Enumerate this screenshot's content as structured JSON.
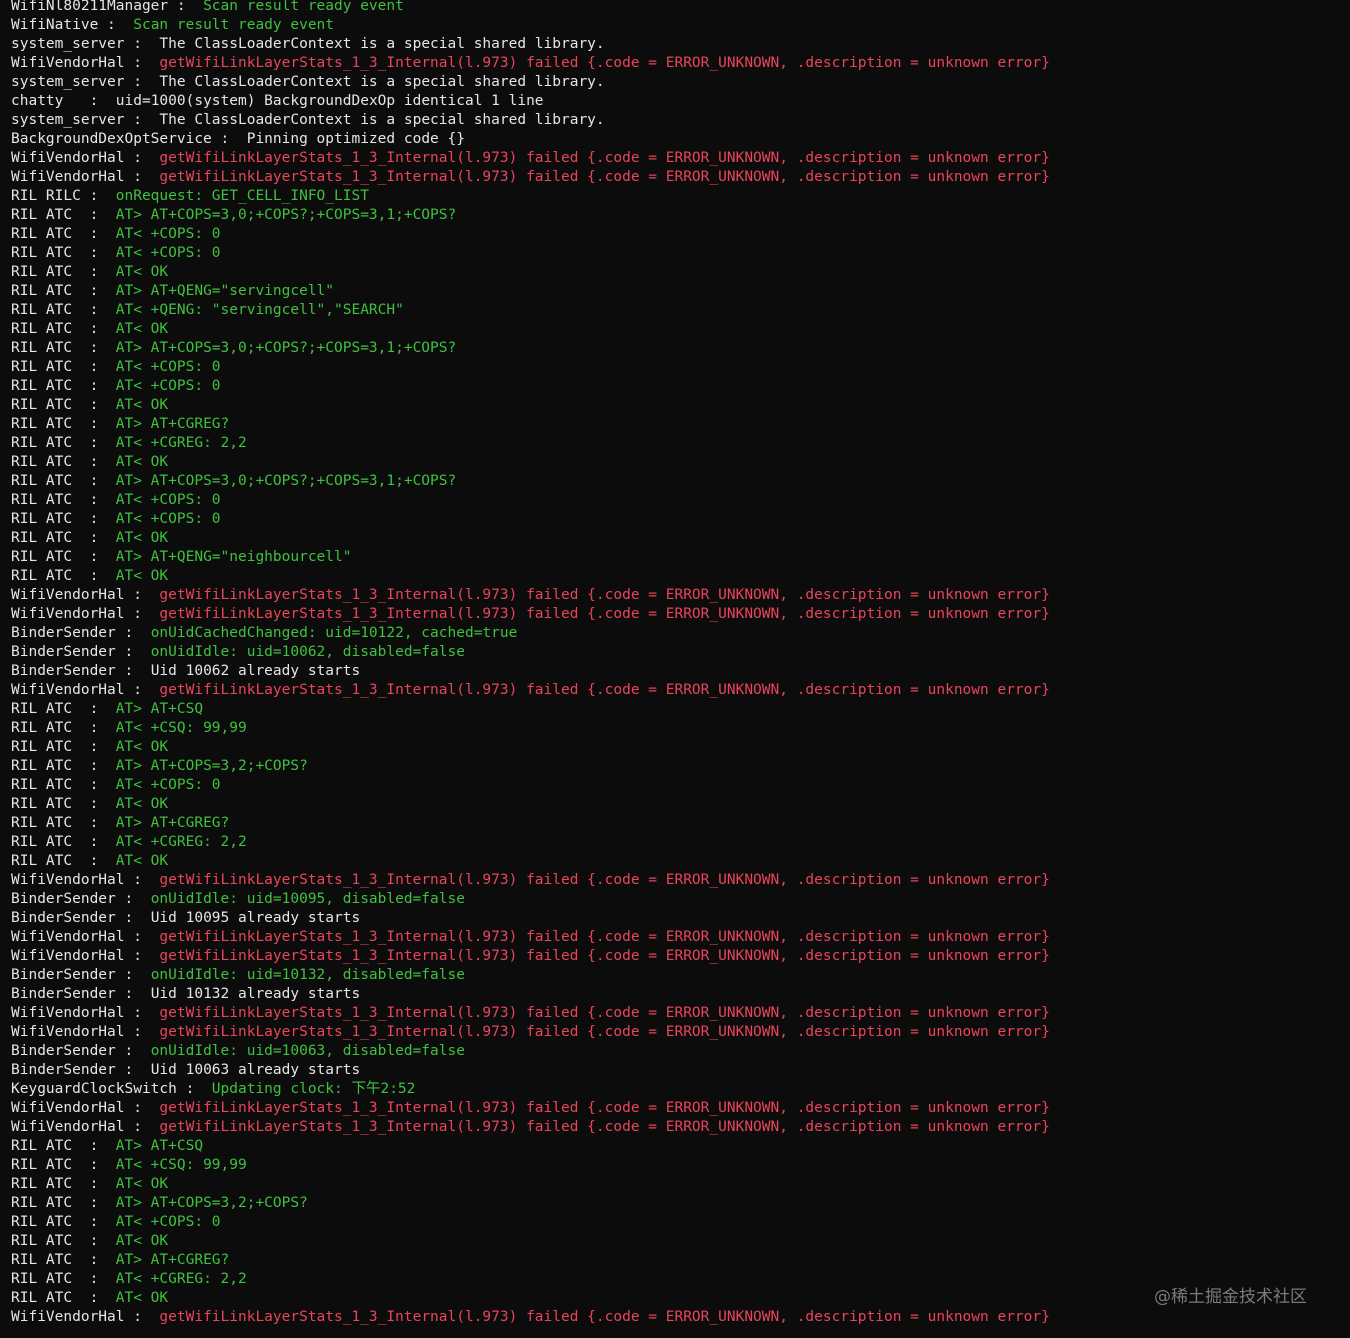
{
  "lines": [
    {
      "tag": "WifiNl80211Manager",
      "sep": " :  ",
      "msg": "Scan result ready event",
      "color": "green"
    },
    {
      "tag": "WifiNative",
      "sep": " :  ",
      "msg": "Scan result ready event",
      "color": "green"
    },
    {
      "tag": "system_server",
      "sep": " :  ",
      "msg": "The ClassLoaderContext is a special shared library.",
      "color": "white"
    },
    {
      "tag": "WifiVendorHal",
      "sep": " :  ",
      "msg": "getWifiLinkLayerStats_1_3_Internal(l.973) failed {.code = ERROR_UNKNOWN, .description = unknown error}",
      "color": "red"
    },
    {
      "tag": "system_server",
      "sep": " :  ",
      "msg": "The ClassLoaderContext is a special shared library.",
      "color": "white"
    },
    {
      "tag": "chatty",
      "sep": "   :  ",
      "msg": "uid=1000(system) BackgroundDexOp identical 1 line",
      "color": "white"
    },
    {
      "tag": "system_server",
      "sep": " :  ",
      "msg": "The ClassLoaderContext is a special shared library.",
      "color": "white"
    },
    {
      "tag": "BackgroundDexOptService",
      "sep": " :  ",
      "msg": "Pinning optimized code {}",
      "color": "white"
    },
    {
      "tag": "WifiVendorHal",
      "sep": " :  ",
      "msg": "getWifiLinkLayerStats_1_3_Internal(l.973) failed {.code = ERROR_UNKNOWN, .description = unknown error}",
      "color": "red"
    },
    {
      "tag": "WifiVendorHal",
      "sep": " :  ",
      "msg": "getWifiLinkLayerStats_1_3_Internal(l.973) failed {.code = ERROR_UNKNOWN, .description = unknown error}",
      "color": "red"
    },
    {
      "tag": "RIL RILC",
      "sep": " :  ",
      "msg": "onRequest: GET_CELL_INFO_LIST",
      "color": "green"
    },
    {
      "tag": "RIL ATC",
      "sep": "  :  ",
      "msg": "AT> AT+COPS=3,0;+COPS?;+COPS=3,1;+COPS?",
      "color": "green"
    },
    {
      "tag": "RIL ATC",
      "sep": "  :  ",
      "msg": "AT< +COPS: 0",
      "color": "green"
    },
    {
      "tag": "RIL ATC",
      "sep": "  :  ",
      "msg": "AT< +COPS: 0",
      "color": "green"
    },
    {
      "tag": "RIL ATC",
      "sep": "  :  ",
      "msg": "AT< OK",
      "color": "green"
    },
    {
      "tag": "RIL ATC",
      "sep": "  :  ",
      "msg": "AT> AT+QENG=\"servingcell\"",
      "color": "green"
    },
    {
      "tag": "RIL ATC",
      "sep": "  :  ",
      "msg": "AT< +QENG: \"servingcell\",\"SEARCH\"",
      "color": "green"
    },
    {
      "tag": "RIL ATC",
      "sep": "  :  ",
      "msg": "AT< OK",
      "color": "green"
    },
    {
      "tag": "RIL ATC",
      "sep": "  :  ",
      "msg": "AT> AT+COPS=3,0;+COPS?;+COPS=3,1;+COPS?",
      "color": "green"
    },
    {
      "tag": "RIL ATC",
      "sep": "  :  ",
      "msg": "AT< +COPS: 0",
      "color": "green"
    },
    {
      "tag": "RIL ATC",
      "sep": "  :  ",
      "msg": "AT< +COPS: 0",
      "color": "green"
    },
    {
      "tag": "RIL ATC",
      "sep": "  :  ",
      "msg": "AT< OK",
      "color": "green"
    },
    {
      "tag": "RIL ATC",
      "sep": "  :  ",
      "msg": "AT> AT+CGREG?",
      "color": "green"
    },
    {
      "tag": "RIL ATC",
      "sep": "  :  ",
      "msg": "AT< +CGREG: 2,2",
      "color": "green"
    },
    {
      "tag": "RIL ATC",
      "sep": "  :  ",
      "msg": "AT< OK",
      "color": "green"
    },
    {
      "tag": "RIL ATC",
      "sep": "  :  ",
      "msg": "AT> AT+COPS=3,0;+COPS?;+COPS=3,1;+COPS?",
      "color": "green"
    },
    {
      "tag": "RIL ATC",
      "sep": "  :  ",
      "msg": "AT< +COPS: 0",
      "color": "green"
    },
    {
      "tag": "RIL ATC",
      "sep": "  :  ",
      "msg": "AT< +COPS: 0",
      "color": "green"
    },
    {
      "tag": "RIL ATC",
      "sep": "  :  ",
      "msg": "AT< OK",
      "color": "green"
    },
    {
      "tag": "RIL ATC",
      "sep": "  :  ",
      "msg": "AT> AT+QENG=\"neighbourcell\"",
      "color": "green"
    },
    {
      "tag": "RIL ATC",
      "sep": "  :  ",
      "msg": "AT< OK",
      "color": "green"
    },
    {
      "tag": "WifiVendorHal",
      "sep": " :  ",
      "msg": "getWifiLinkLayerStats_1_3_Internal(l.973) failed {.code = ERROR_UNKNOWN, .description = unknown error}",
      "color": "red"
    },
    {
      "tag": "WifiVendorHal",
      "sep": " :  ",
      "msg": "getWifiLinkLayerStats_1_3_Internal(l.973) failed {.code = ERROR_UNKNOWN, .description = unknown error}",
      "color": "red"
    },
    {
      "tag": "BinderSender",
      "sep": " :  ",
      "msg": "onUidCachedChanged: uid=10122, cached=true",
      "color": "green"
    },
    {
      "tag": "BinderSender",
      "sep": " :  ",
      "msg": "onUidIdle: uid=10062, disabled=false",
      "color": "green"
    },
    {
      "tag": "BinderSender",
      "sep": " :  ",
      "msg": "Uid 10062 already starts",
      "color": "white"
    },
    {
      "tag": "WifiVendorHal",
      "sep": " :  ",
      "msg": "getWifiLinkLayerStats_1_3_Internal(l.973) failed {.code = ERROR_UNKNOWN, .description = unknown error}",
      "color": "red"
    },
    {
      "tag": "RIL ATC",
      "sep": "  :  ",
      "msg": "AT> AT+CSQ",
      "color": "green"
    },
    {
      "tag": "RIL ATC",
      "sep": "  :  ",
      "msg": "AT< +CSQ: 99,99",
      "color": "green"
    },
    {
      "tag": "RIL ATC",
      "sep": "  :  ",
      "msg": "AT< OK",
      "color": "green"
    },
    {
      "tag": "RIL ATC",
      "sep": "  :  ",
      "msg": "AT> AT+COPS=3,2;+COPS?",
      "color": "green"
    },
    {
      "tag": "RIL ATC",
      "sep": "  :  ",
      "msg": "AT< +COPS: 0",
      "color": "green"
    },
    {
      "tag": "RIL ATC",
      "sep": "  :  ",
      "msg": "AT< OK",
      "color": "green"
    },
    {
      "tag": "RIL ATC",
      "sep": "  :  ",
      "msg": "AT> AT+CGREG?",
      "color": "green"
    },
    {
      "tag": "RIL ATC",
      "sep": "  :  ",
      "msg": "AT< +CGREG: 2,2",
      "color": "green"
    },
    {
      "tag": "RIL ATC",
      "sep": "  :  ",
      "msg": "AT< OK",
      "color": "green"
    },
    {
      "tag": "WifiVendorHal",
      "sep": " :  ",
      "msg": "getWifiLinkLayerStats_1_3_Internal(l.973) failed {.code = ERROR_UNKNOWN, .description = unknown error}",
      "color": "red"
    },
    {
      "tag": "BinderSender",
      "sep": " :  ",
      "msg": "onUidIdle: uid=10095, disabled=false",
      "color": "green"
    },
    {
      "tag": "BinderSender",
      "sep": " :  ",
      "msg": "Uid 10095 already starts",
      "color": "white"
    },
    {
      "tag": "WifiVendorHal",
      "sep": " :  ",
      "msg": "getWifiLinkLayerStats_1_3_Internal(l.973) failed {.code = ERROR_UNKNOWN, .description = unknown error}",
      "color": "red"
    },
    {
      "tag": "WifiVendorHal",
      "sep": " :  ",
      "msg": "getWifiLinkLayerStats_1_3_Internal(l.973) failed {.code = ERROR_UNKNOWN, .description = unknown error}",
      "color": "red"
    },
    {
      "tag": "BinderSender",
      "sep": " :  ",
      "msg": "onUidIdle: uid=10132, disabled=false",
      "color": "green"
    },
    {
      "tag": "BinderSender",
      "sep": " :  ",
      "msg": "Uid 10132 already starts",
      "color": "white"
    },
    {
      "tag": "WifiVendorHal",
      "sep": " :  ",
      "msg": "getWifiLinkLayerStats_1_3_Internal(l.973) failed {.code = ERROR_UNKNOWN, .description = unknown error}",
      "color": "red"
    },
    {
      "tag": "WifiVendorHal",
      "sep": " :  ",
      "msg": "getWifiLinkLayerStats_1_3_Internal(l.973) failed {.code = ERROR_UNKNOWN, .description = unknown error}",
      "color": "red"
    },
    {
      "tag": "BinderSender",
      "sep": " :  ",
      "msg": "onUidIdle: uid=10063, disabled=false",
      "color": "green"
    },
    {
      "tag": "BinderSender",
      "sep": " :  ",
      "msg": "Uid 10063 already starts",
      "color": "white"
    },
    {
      "tag": "KeyguardClockSwitch",
      "sep": " :  ",
      "msg": "Updating clock: 下午2:52",
      "color": "green"
    },
    {
      "tag": "WifiVendorHal",
      "sep": " :  ",
      "msg": "getWifiLinkLayerStats_1_3_Internal(l.973) failed {.code = ERROR_UNKNOWN, .description = unknown error}",
      "color": "red"
    },
    {
      "tag": "WifiVendorHal",
      "sep": " :  ",
      "msg": "getWifiLinkLayerStats_1_3_Internal(l.973) failed {.code = ERROR_UNKNOWN, .description = unknown error}",
      "color": "red"
    },
    {
      "tag": "RIL ATC",
      "sep": "  :  ",
      "msg": "AT> AT+CSQ",
      "color": "green"
    },
    {
      "tag": "RIL ATC",
      "sep": "  :  ",
      "msg": "AT< +CSQ: 99,99",
      "color": "green"
    },
    {
      "tag": "RIL ATC",
      "sep": "  :  ",
      "msg": "AT< OK",
      "color": "green"
    },
    {
      "tag": "RIL ATC",
      "sep": "  :  ",
      "msg": "AT> AT+COPS=3,2;+COPS?",
      "color": "green"
    },
    {
      "tag": "RIL ATC",
      "sep": "  :  ",
      "msg": "AT< +COPS: 0",
      "color": "green"
    },
    {
      "tag": "RIL ATC",
      "sep": "  :  ",
      "msg": "AT< OK",
      "color": "green"
    },
    {
      "tag": "RIL ATC",
      "sep": "  :  ",
      "msg": "AT> AT+CGREG?",
      "color": "green"
    },
    {
      "tag": "RIL ATC",
      "sep": "  :  ",
      "msg": "AT< +CGREG: 2,2",
      "color": "green"
    },
    {
      "tag": "RIL ATC",
      "sep": "  :  ",
      "msg": "AT< OK",
      "color": "green"
    },
    {
      "tag": "WifiVendorHal",
      "sep": " :  ",
      "msg": "getWifiLinkLayerStats_1_3_Internal(l.973) failed {.code = ERROR_UNKNOWN, .description = unknown error}",
      "color": "red"
    }
  ],
  "watermark": "@稀土掘金技术社区",
  "colors": {
    "background": "#0c0c0c",
    "default_text": "#e6e6e6",
    "green": "#3fc13f",
    "red": "#e8455a",
    "watermark": "#7a7a7a"
  }
}
